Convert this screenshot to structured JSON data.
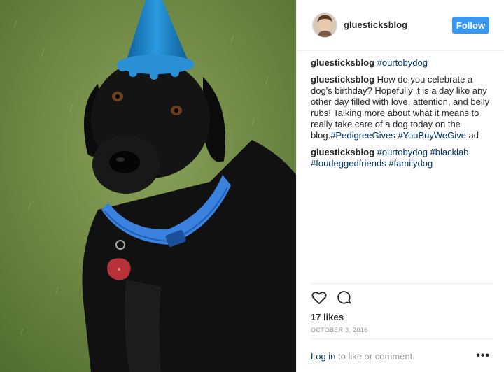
{
  "post": {
    "username": "gluesticksblog",
    "follow_label": "Follow",
    "likes": "17 likes",
    "date": "OCTOBER 3, 2016",
    "login_link": "Log in",
    "login_rest": " to like or comment.",
    "more": "•••"
  },
  "comments": [
    {
      "user": "gluesticksblog",
      "segments": [
        {
          "text": "#ourtobydog",
          "type": "tag"
        }
      ]
    },
    {
      "user": "gluesticksblog",
      "segments": [
        {
          "text": "How do you celebrate a dog's birthday? Hopefully it is a day like any other day filled with love, attention, and belly rubs! Talking more about what it means to really take care of a dog today on the blog.",
          "type": "text"
        },
        {
          "text": "#PedigreeGives",
          "type": "tag"
        },
        {
          "text": " ",
          "type": "text"
        },
        {
          "text": "#YouBuyWeGive",
          "type": "tag"
        },
        {
          "text": " ad",
          "type": "text"
        }
      ]
    },
    {
      "user": "gluesticksblog",
      "segments": [
        {
          "text": "#ourtobydog",
          "type": "tag"
        },
        {
          "text": " ",
          "type": "text"
        },
        {
          "text": "#blacklab",
          "type": "tag"
        },
        {
          "text": " ",
          "type": "text"
        },
        {
          "text": "#fourleggedfriends",
          "type": "tag"
        },
        {
          "text": " ",
          "type": "text"
        },
        {
          "text": "#familydog",
          "type": "tag"
        }
      ]
    }
  ],
  "colors": {
    "follow_bg": "#3897f0",
    "hashtag": "#003569",
    "collar": "#3b82e0",
    "hat": "#1e7fc4"
  },
  "icons": [
    "heart-icon",
    "comment-icon",
    "more-options-icon"
  ]
}
